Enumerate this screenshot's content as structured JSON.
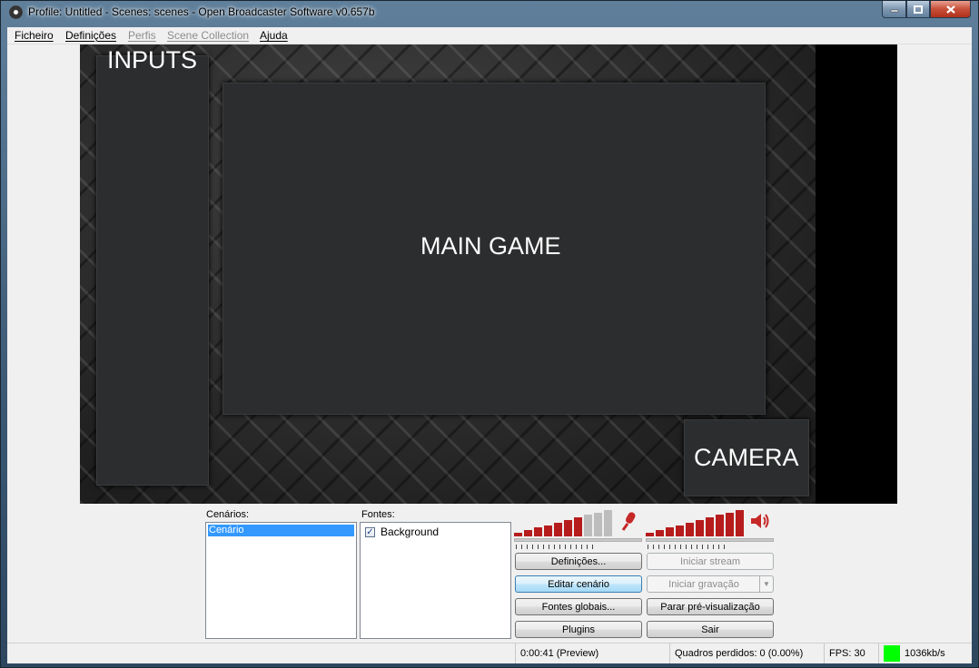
{
  "window": {
    "title": "Profile: Untitled - Scenes: scenes - Open Broadcaster Software v0.657b",
    "min_icon": "minimize-icon",
    "max_icon": "maximize-icon",
    "close_icon": "close-icon"
  },
  "menu": [
    {
      "label": "Ficheiro",
      "enabled": true
    },
    {
      "label": "Definições",
      "enabled": true
    },
    {
      "label": "Perfis",
      "enabled": false
    },
    {
      "label": "Scene Collection",
      "enabled": false
    },
    {
      "label": "Ajuda",
      "enabled": true
    }
  ],
  "preview": {
    "inputs_label": "INPUTS",
    "main_label": "MAIN GAME",
    "camera_label": "CAMERA"
  },
  "scenes": {
    "label": "Cenários:",
    "items": [
      "Cenário"
    ],
    "selected": "Cenário"
  },
  "sources": {
    "label": "Fontes:",
    "items": [
      {
        "name": "Background",
        "checked": true
      }
    ]
  },
  "audio": {
    "mic_icon": "microphone-icon",
    "speaker_icon": "speaker-icon",
    "mic_level": 0.7,
    "desktop_level": 1.0,
    "colors": {
      "active": "#b71c1c",
      "inactive": "#bdbdbd"
    }
  },
  "buttons": {
    "settings": "Definições...",
    "start_stream": "Iniciar stream",
    "edit_scene": "Editar cenário",
    "start_recording": "Iniciar gravação",
    "global_sources": "Fontes globais...",
    "stop_preview": "Parar pré-visualização",
    "plugins": "Plugins",
    "exit": "Sair"
  },
  "status": {
    "time": "0:00:41 (Preview)",
    "dropped_frames": "Quadros perdidos: 0 (0.00%)",
    "fps": "FPS: 30",
    "bitrate": "1036kb/s",
    "bitrate_color": "#00ff00"
  }
}
